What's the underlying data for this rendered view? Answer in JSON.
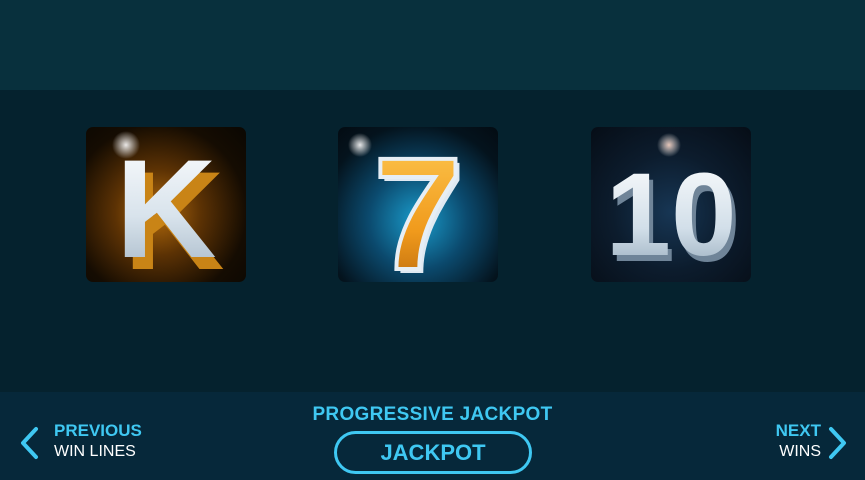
{
  "reels": {
    "symbols": [
      {
        "text": "K",
        "style": "gold-glow"
      },
      {
        "text": "7",
        "style": "blue-glow"
      },
      {
        "text": "10",
        "style": "dark-blue"
      }
    ]
  },
  "footer": {
    "prev_top": "PREVIOUS",
    "prev_bottom": "WIN LINES",
    "jackpot_title": "PROGRESSIVE JACKPOT",
    "jackpot_value": "JACKPOT",
    "next_top": "NEXT",
    "next_bottom": "WINS"
  },
  "colors": {
    "accent": "#3fc8f2",
    "background": "#05222e",
    "bar": "#06283a"
  },
  "icons": {
    "prev": "chevron-left-icon",
    "next": "chevron-right-icon"
  }
}
